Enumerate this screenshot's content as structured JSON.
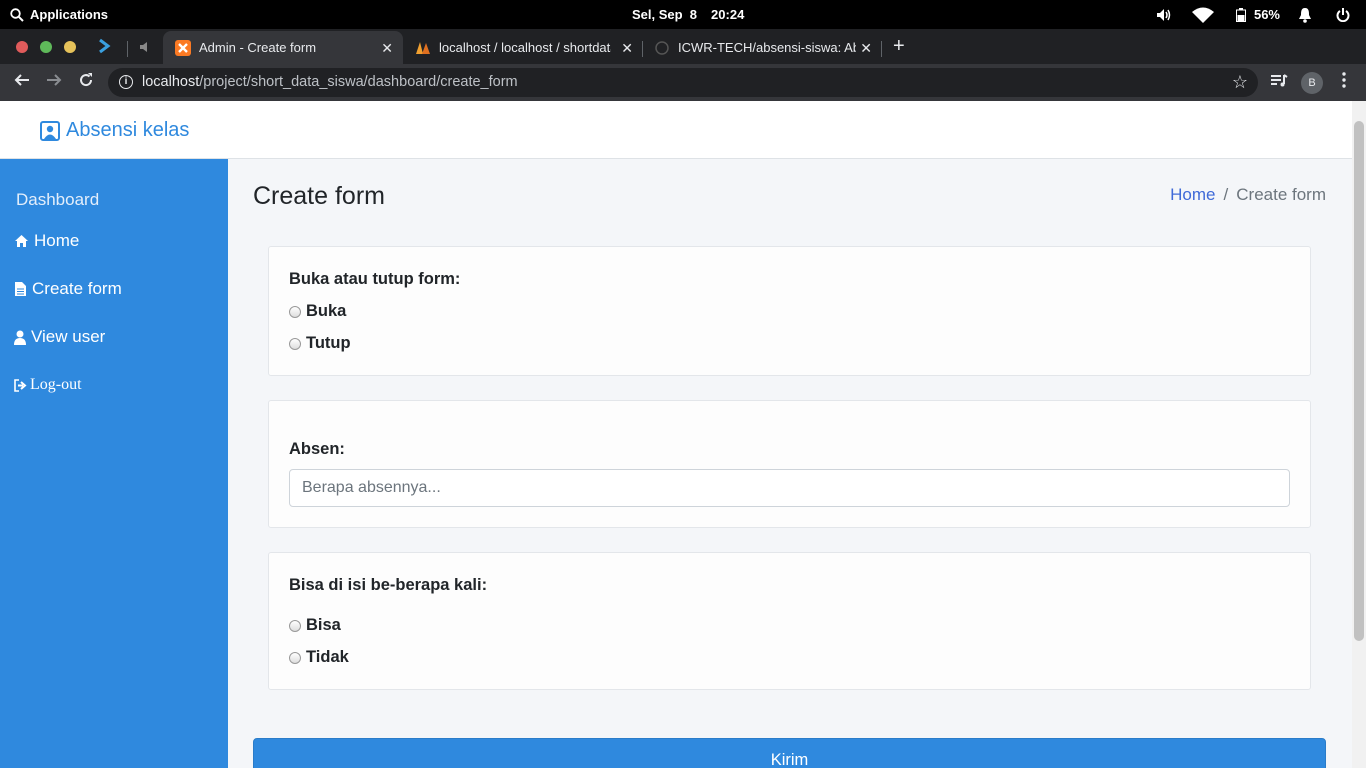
{
  "system": {
    "apps_label": "Applications",
    "date": "Sel, Sep  8",
    "time": "20:24",
    "battery": "56%"
  },
  "tabs": [
    {
      "title": "Admin - Create form",
      "icon": "xampp-icon"
    },
    {
      "title": "localhost / localhost / shortdata",
      "icon": "phpmyadmin-icon"
    },
    {
      "title": "ICWR-TECH/absensi-siswa: Abs",
      "icon": "github-icon"
    }
  ],
  "url": {
    "host": "localhost",
    "path": "/project/short_data_siswa/dashboard/create_form"
  },
  "profile_initial": "B",
  "brand": "Absensi kelas",
  "sidebar": {
    "header": "Dashboard",
    "items": [
      {
        "label": "Home",
        "icon": "home-icon"
      },
      {
        "label": "Create form",
        "icon": "file-icon"
      },
      {
        "label": "View user",
        "icon": "user-icon"
      },
      {
        "label": "Log-out",
        "icon": "sign-out-icon"
      }
    ]
  },
  "page": {
    "title": "Create form",
    "breadcrumb": {
      "home": "Home",
      "separator": "/",
      "current": "Create form"
    }
  },
  "form": {
    "open_close": {
      "label": "Buka atau tutup form:",
      "options": [
        "Buka",
        "Tutup"
      ]
    },
    "absen": {
      "label": "Absen:",
      "placeholder": "Berapa absennya..."
    },
    "repeat": {
      "label": "Bisa di isi be-berapa kali:",
      "options": [
        "Bisa",
        "Tidak"
      ]
    },
    "submit": "Kirim"
  },
  "colors": {
    "accent": "#2f89de",
    "link": "#3f6ad8"
  }
}
